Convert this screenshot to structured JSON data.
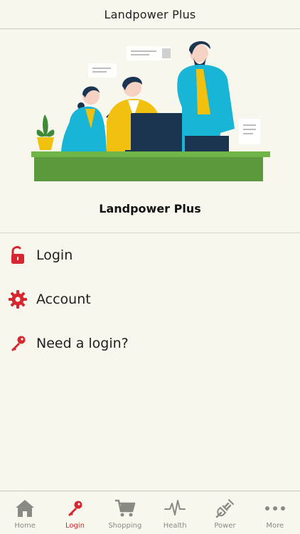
{
  "header": {
    "title": "Landpower Plus"
  },
  "app": {
    "name": "Landpower Plus"
  },
  "menu": {
    "items": [
      {
        "label": "Login",
        "icon": "unlock-icon"
      },
      {
        "label": "Account",
        "icon": "gear-icon"
      },
      {
        "label": "Need a login?",
        "icon": "key-icon"
      }
    ]
  },
  "tabbar": {
    "active": "Login",
    "tabs": [
      {
        "label": "Home",
        "icon": "home-icon"
      },
      {
        "label": "Login",
        "icon": "key-icon"
      },
      {
        "label": "Shopping",
        "icon": "cart-icon"
      },
      {
        "label": "Health",
        "icon": "pulse-icon"
      },
      {
        "label": "Power",
        "icon": "plug-icon"
      },
      {
        "label": "More",
        "icon": "more-icon"
      }
    ]
  },
  "colors": {
    "background": "#f8f7ee",
    "accent": "#d7262f",
    "tab_inactive": "#8a8a84",
    "table_green": "#5a9a3c"
  }
}
